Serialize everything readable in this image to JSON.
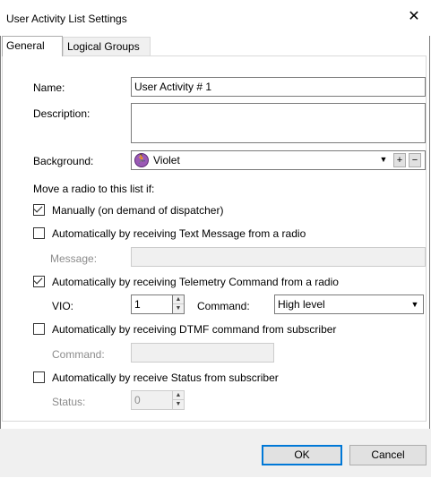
{
  "window": {
    "title": "User Activity List Settings",
    "close_glyph": "✕"
  },
  "tabs": [
    {
      "label": "General",
      "active": true
    },
    {
      "label": "Logical Groups",
      "active": false
    }
  ],
  "form": {
    "name_label": "Name:",
    "name_value": "User Activity # 1",
    "description_label": "Description:",
    "description_value": "",
    "background_label": "Background:",
    "background_value": "Violet",
    "background_icon": "running-person-icon",
    "background_icon_color": "#9b59b6",
    "bg_dropdown_glyph": "▼",
    "bg_add_glyph": "+",
    "bg_remove_glyph": "−",
    "move_heading": "Move a radio to this list if:",
    "manual_label": "Manually (on demand of dispatcher)",
    "manual_checked": true,
    "text_msg_label": "Automatically by receiving Text Message from a radio",
    "text_msg_checked": false,
    "message_label": "Message:",
    "message_value": "",
    "telemetry_label": "Automatically by receiving Telemetry Command from a radio",
    "telemetry_checked": true,
    "vio_label": "VIO:",
    "vio_value": "1",
    "command_label": "Command:",
    "command_value": "High level",
    "dtmf_label": "Automatically by receiving DTMF command from subscriber",
    "dtmf_checked": false,
    "dtmf_command_label": "Command:",
    "dtmf_command_value": "",
    "status_label_cb": "Automatically by receive Status from subscriber",
    "status_checked": false,
    "status_label": "Status:",
    "status_value": "0",
    "spin_up_glyph": "▲",
    "spin_down_glyph": "▼",
    "combo_arrow_glyph": "▼"
  },
  "buttons": {
    "ok": "OK",
    "cancel": "Cancel"
  }
}
